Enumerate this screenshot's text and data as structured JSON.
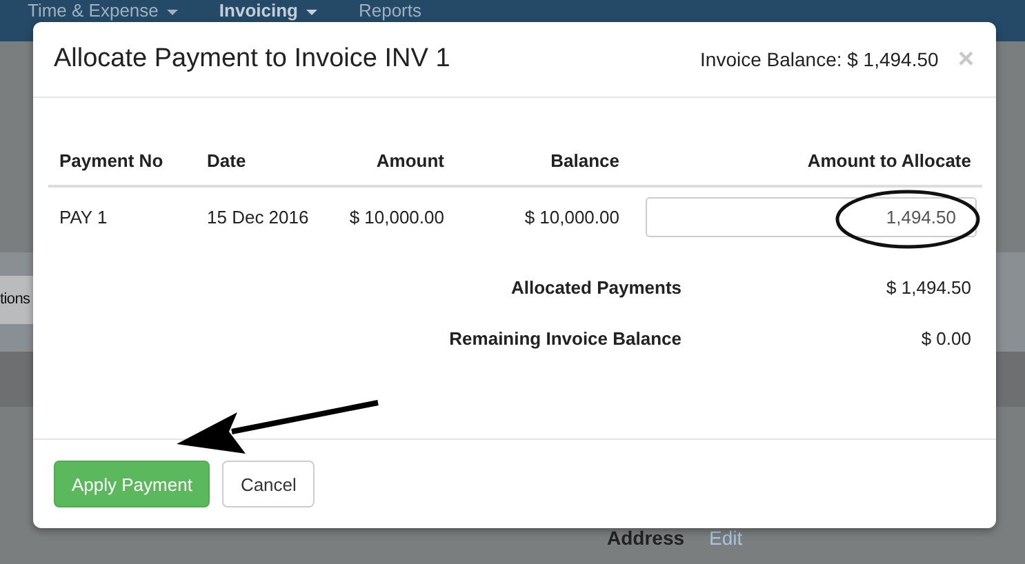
{
  "nav": [
    {
      "label": "Time & Expense",
      "dropdown": true,
      "selected": false
    },
    {
      "label": "Invoicing",
      "dropdown": true,
      "selected": true
    },
    {
      "label": "Reports",
      "dropdown": false,
      "selected": false
    }
  ],
  "background": {
    "tab_text": "tions",
    "address_label": "Address",
    "address_link": "Edit"
  },
  "modal": {
    "title": "Allocate Payment to Invoice INV 1",
    "balance": "Invoice Balance: $ 1,494.50",
    "close": "×",
    "table": {
      "columns": [
        "Payment No",
        "Date",
        "Amount",
        "Balance",
        "Amount to Allocate"
      ],
      "rows": [
        {
          "payment_no": "PAY 1",
          "date": "15 Dec 2016",
          "amount": "$ 10,000.00",
          "balance": "$ 10,000.00",
          "allocate": "1,494.50"
        }
      ]
    },
    "totals": [
      {
        "label": "Allocated Payments",
        "value": "$ 1,494.50"
      },
      {
        "label": "Remaining Invoice Balance",
        "value": "$ 0.00"
      }
    ],
    "buttons": [
      {
        "label": "Apply Payment",
        "kind": "primary"
      },
      {
        "label": "Cancel",
        "kind": "default"
      }
    ]
  }
}
